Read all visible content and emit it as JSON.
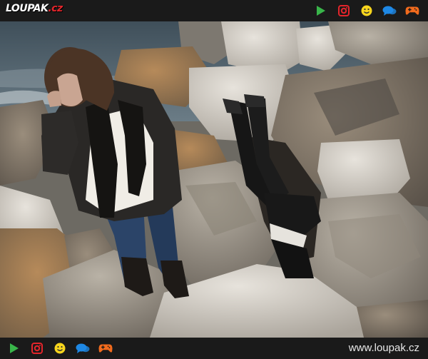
{
  "brand": {
    "logo_text": "LOUPAK",
    "logo_tld": ".cz"
  },
  "top_icons": [
    "play-icon",
    "instagram-icon",
    "smiley-icon",
    "chat-icon",
    "gamepad-icon"
  ],
  "bottom_icons": [
    "play-icon",
    "instagram-icon",
    "smiley-icon",
    "chat-icon",
    "gamepad-icon"
  ],
  "footer": {
    "site_url": "www.loupak.cz"
  },
  "colors": {
    "bar": "#1a1a1a",
    "play": "#39b54a",
    "instagram": "#e3252b",
    "smiley": "#f7d51d",
    "chat": "#1e88e5",
    "gamepad": "#f26b1d"
  }
}
